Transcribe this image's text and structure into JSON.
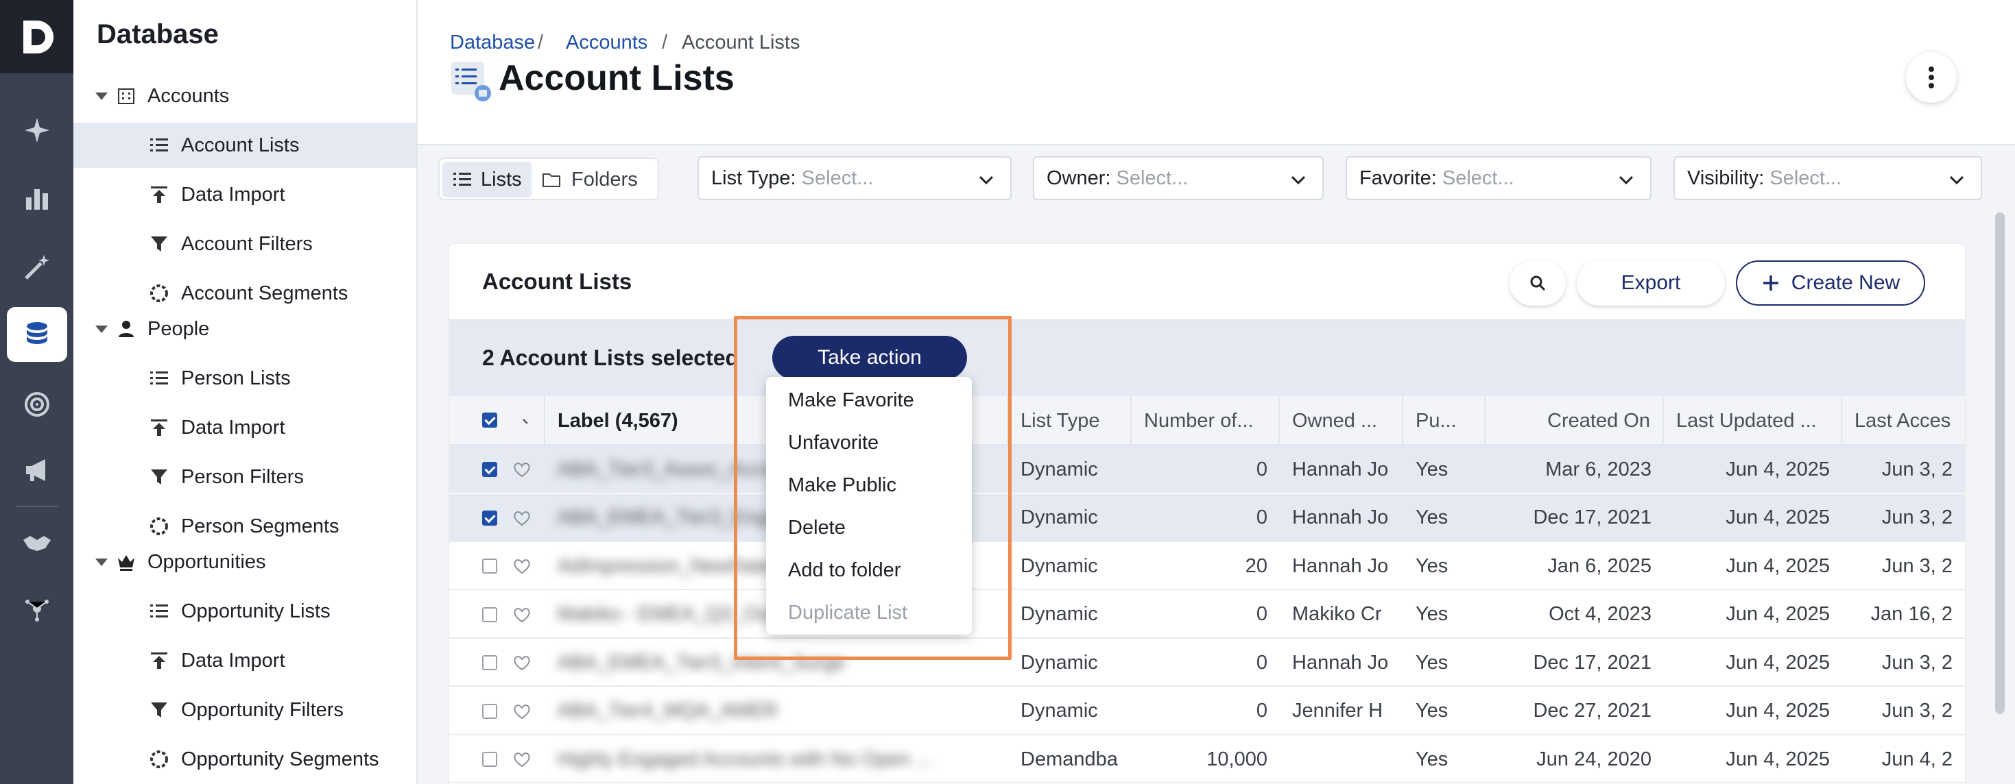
{
  "app": {
    "brand": "Database",
    "logo_letter": "D"
  },
  "rail": {
    "items": [
      "sparkle-icon",
      "bar-chart-icon",
      "magic-wand-icon",
      "database-icon",
      "target-icon",
      "megaphone-icon",
      "handshake-icon",
      "network-icon"
    ],
    "active": "database-icon"
  },
  "sidebar": {
    "groups": [
      {
        "label": "Accounts",
        "items": [
          "Account Lists",
          "Data Import",
          "Account Filters",
          "Account Segments"
        ]
      },
      {
        "label": "People",
        "items": [
          "Person Lists",
          "Data Import",
          "Person Filters",
          "Person Segments"
        ]
      },
      {
        "label": "Opportunities",
        "items": [
          "Opportunity Lists",
          "Data Import",
          "Opportunity Filters",
          "Opportunity Segments"
        ]
      }
    ],
    "active_item": "Account Lists"
  },
  "header": {
    "breadcrumb": [
      "Database",
      "Accounts",
      "Account Lists"
    ],
    "title": "Account Lists"
  },
  "view_toggle": {
    "lists": "Lists",
    "folders": "Folders",
    "active": "Lists"
  },
  "filters": [
    {
      "label": "List Type:",
      "placeholder": "Select..."
    },
    {
      "label": "Owner:",
      "placeholder": "Select..."
    },
    {
      "label": "Favorite:",
      "placeholder": "Select..."
    },
    {
      "label": "Visibility:",
      "placeholder": "Select..."
    }
  ],
  "card": {
    "title": "Account Lists",
    "export_label": "Export",
    "create_label": "Create New",
    "selection_text": "2 Account Lists selected",
    "take_action_label": "Take action"
  },
  "table": {
    "columns": [
      "Label (4,567)",
      "List Type",
      "Number of...",
      "Owned ...",
      "Pu...",
      "Created On",
      "Last Updated ...",
      "Last Acces"
    ],
    "rows": [
      {
        "checked": true,
        "label": "ABA_Tier3_Assoc_Accounts",
        "type": "Dynamic",
        "count": "0",
        "owner": "Hannah Jo",
        "public": "Yes",
        "created": "Mar 6, 2023",
        "updated": "Jun 4, 2025",
        "accessed": "Jun 3, 2"
      },
      {
        "checked": true,
        "label": "ABA_EMEA_Tier3_Engaged",
        "type": "Dynamic",
        "count": "0",
        "owner": "Hannah Jo",
        "public": "Yes",
        "created": "Dec 17, 2021",
        "updated": "Jun 4, 2025",
        "accessed": "Jun 3, 2"
      },
      {
        "checked": false,
        "label": "AdImpression_NewData",
        "type": "Dynamic",
        "count": "20",
        "owner": "Hannah Jo",
        "public": "Yes",
        "created": "Jan 6, 2025",
        "updated": "Jun 4, 2025",
        "accessed": "Jun 3, 2"
      },
      {
        "checked": false,
        "label": "Makiko - EMEA_Q3_Outreach_List",
        "type": "Dynamic",
        "count": "0",
        "owner": "Makiko Cr",
        "public": "Yes",
        "created": "Oct 4, 2023",
        "updated": "Jun 4, 2025",
        "accessed": "Jan 16, 2"
      },
      {
        "checked": false,
        "label": "ABA_EMEA_Tier3_Intent_Surge",
        "type": "Dynamic",
        "count": "0",
        "owner": "Hannah Jo",
        "public": "Yes",
        "created": "Dec 17, 2021",
        "updated": "Jun 4, 2025",
        "accessed": "Jun 3, 2"
      },
      {
        "checked": false,
        "label": "ABA_Tier4_MQA_AMER",
        "type": "Dynamic",
        "count": "0",
        "owner": "Jennifer H",
        "public": "Yes",
        "created": "Dec 27, 2021",
        "updated": "Jun 4, 2025",
        "accessed": "Jun 3, 2"
      },
      {
        "checked": false,
        "label": "Highly Engaged Accounts with No Open ...",
        "type": "Demandba",
        "count": "10,000",
        "owner": "",
        "public": "Yes",
        "created": "Jun 24, 2020",
        "updated": "Jun 4, 2025",
        "accessed": "Jun 4, 2"
      }
    ]
  },
  "menu": {
    "items": [
      "Make Favorite",
      "Unfavorite",
      "Make Public",
      "Delete",
      "Add to folder",
      "Duplicate List"
    ],
    "disabled": [
      "Duplicate List"
    ]
  },
  "colors": {
    "accent": "#1b2a6b",
    "link": "#1f4fa8",
    "highlight": "#ee8a4b",
    "rail": "#3a4150",
    "selected_row": "#e4e9f2"
  }
}
